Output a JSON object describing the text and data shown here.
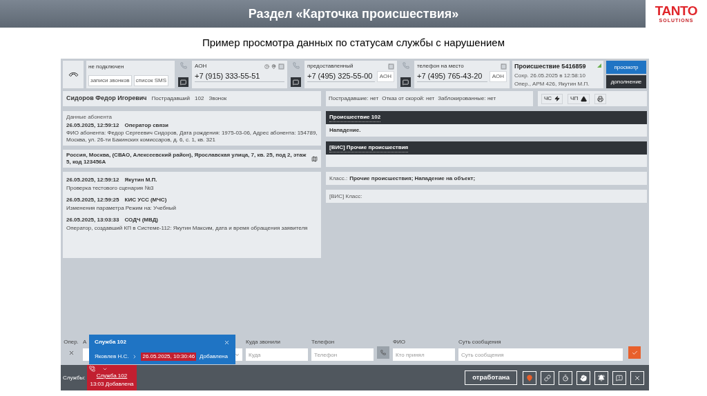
{
  "header": {
    "title": "Раздел «Карточка происшествия»",
    "logo": "TANTO",
    "logo_sub": "SOLUTIONS"
  },
  "subtitle": "Пример просмотра данных по статусам службы с нарушением",
  "call_panel": {
    "status": "не подключен",
    "buttons": [
      "записи звонков",
      "список SMS"
    ]
  },
  "phones": [
    {
      "kind": "aoh",
      "label": "АОН",
      "number": "+7 (915) 333-55-51"
    },
    {
      "kind": "plain",
      "label": "предоставленный",
      "number": "+7 (495) 325-55-00",
      "button": "АОН"
    },
    {
      "kind": "plain",
      "label": "телефон на место",
      "number": "+7 (495) 765-43-20",
      "button": "АОН"
    }
  ],
  "incident": {
    "title": "Происшествие 5416859",
    "saved": "Сохр. 26.05.2025 в 12:58:10",
    "operator": "Опер., АРМ 426, Якутин М.П."
  },
  "actions": [
    {
      "kind": "primary",
      "label": "просмотр"
    },
    {
      "kind": "dark",
      "label": "дополнение"
    }
  ],
  "caller": {
    "name": "Сидоров Федор Игоревич",
    "role": "Пострадавший",
    "service": "102",
    "source": "Звонок"
  },
  "flags": [
    "Пострадавшие: нет",
    "Отказ от скорой: нет",
    "Заблокированные: нет"
  ],
  "tools": [
    {
      "kind": "emergency",
      "label": "ЧС"
    },
    {
      "kind": "incident",
      "label": "ЧП"
    },
    {
      "kind": "print"
    }
  ],
  "subscriber": {
    "heading": "Данные абонента",
    "stamp": "26.05.2025, 12:59:12",
    "source": "Оператор связи",
    "text": "ФИО абонента: Федор Сергеевич Сидоров, Дата рождения: 1975-03-06, Адрес абонента: 154789, Москва, ул. 26-ти Бакинских комиссаров, д. 6, с. 1, кв. 321"
  },
  "address": "Россия, Москва, (СВАО, Алексеевский район), Ярославская улица, 7, кв. 25, под 2, этаж 5, код 123456А",
  "log": [
    {
      "time": "26.05.2025, 12:59:12",
      "author": "Якутин М.П.",
      "text": "Проверка тестового сценария №3"
    },
    {
      "time": "26.05.2025, 12:59:25",
      "author": "КИС УСС (МЧС)",
      "text": "Изменения параметра Режим на: Учебный"
    },
    {
      "time": "26.05.2025, 13:03:33",
      "author": "СОДЧ (МВД)",
      "text": "Оператор, создавший КП в Системе-112: Якутин Максим, дата и время обращения заявителя"
    }
  ],
  "sections": [
    {
      "title": "Происшествие 102",
      "body": "Нападение."
    },
    {
      "title": "[ВИС] Прочие происшествия"
    }
  ],
  "class_rows": [
    {
      "label": "Класс.:",
      "value": "Прочие происшествия; Нападение на объект;"
    },
    {
      "label": "[ВИС] Класс:"
    }
  ],
  "form": {
    "operator_label": "Опер.",
    "second_label": "А",
    "fields": [
      {
        "label": "Куда звонили",
        "placeholder": "Куда"
      },
      {
        "label": "Телефон",
        "placeholder": "Телефон"
      },
      {
        "label": "ФИО",
        "placeholder": "Кто принял"
      },
      {
        "label": "Суть сообщения",
        "placeholder": "Суть сообщения"
      }
    ]
  },
  "popup": {
    "title": "Служба 102",
    "person": "Яковлев Н.С.",
    "time": "26.05.2025, 10:30:46",
    "status": "Добавлена"
  },
  "services_bar": {
    "label": "Службы:",
    "tabs": [
      {
        "name": "Служба 102",
        "sub": "13:03 Добавлена",
        "selected": true
      }
    ],
    "done_button": "отработана"
  }
}
